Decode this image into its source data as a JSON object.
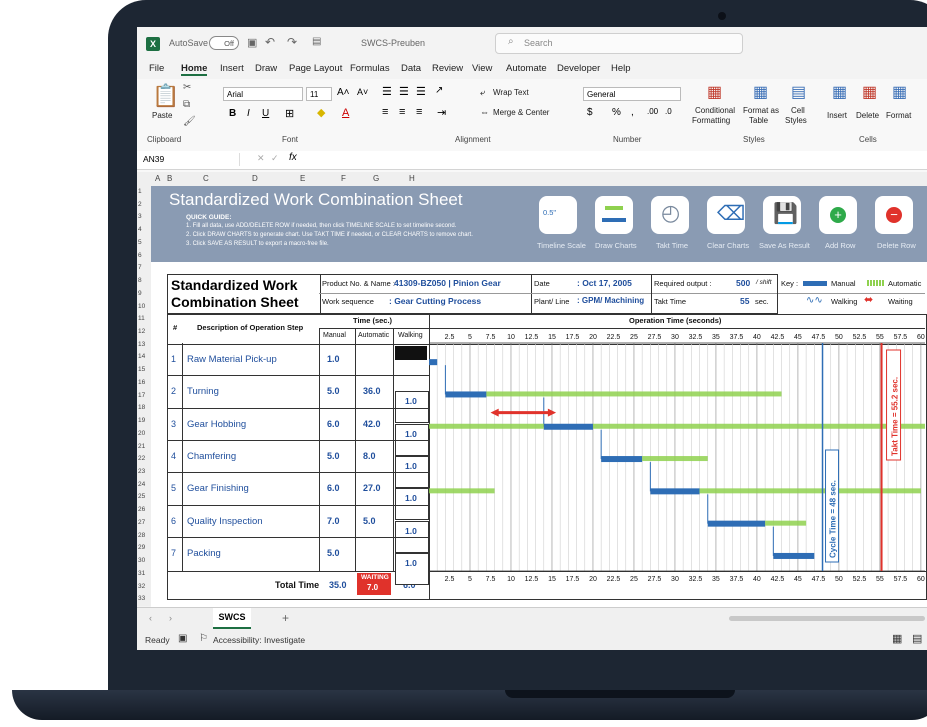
{
  "titlebar": {
    "autosave_label": "AutoSave",
    "autosave_state": "Off",
    "filename": "SWCS-Preuben",
    "search_placeholder": "Search"
  },
  "menu": [
    "File",
    "Home",
    "Insert",
    "Draw",
    "Page Layout",
    "Formulas",
    "Data",
    "Review",
    "View",
    "Automate",
    "Developer",
    "Help"
  ],
  "ribbon": {
    "paste": "Paste",
    "font_name": "Arial",
    "font_size": "11",
    "wrap_text": "Wrap Text",
    "merge_center": "Merge & Center",
    "number_format": "General",
    "conditional": "Conditional",
    "formatting": "Formatting",
    "format_as": "Format as",
    "table": "Table",
    "cell": "Cell",
    "styles": "Styles",
    "insert": "Insert",
    "delete": "Delete",
    "format": "Format",
    "groups": {
      "clipboard": "Clipboard",
      "font": "Font",
      "alignment": "Alignment",
      "number": "Number",
      "styles": "Styles",
      "cells": "Cells"
    }
  },
  "formula_bar": {
    "name_box": "AN39",
    "fx": "fx"
  },
  "columns": [
    "A",
    "B",
    "C",
    "D",
    "E",
    "F",
    "G",
    "H"
  ],
  "rows": [
    "1",
    "2",
    "3",
    "4",
    "5",
    "6",
    "7",
    "8",
    "9",
    "10",
    "11",
    "12",
    "13",
    "14",
    "15",
    "16",
    "17",
    "18",
    "19",
    "20",
    "21",
    "22",
    "23",
    "24",
    "25",
    "26",
    "27",
    "28",
    "29",
    "30",
    "31",
    "32",
    "33"
  ],
  "banner": {
    "title": "Standardized Work Combination Sheet",
    "guide_title": "QUICK GUIDE:",
    "guide_lines": [
      "1. Fill all data, use ADD/DELETE ROW if needed, then click TIMELINE SCALE to set timeline second.",
      "2. Click DRAW CHARTS to generate chart. Use TAKT TIME if needed, or CLEAR CHARTS to remove chart.",
      "3. Click SAVE AS RESULT to export a macro-free file."
    ],
    "scale_value": "0.5\"",
    "buttons": [
      "Timeline Scale",
      "Draw Charts",
      "Takt Time",
      "Clear Charts",
      "Save As Result",
      "Add Row",
      "Delete Row"
    ]
  },
  "sheet": {
    "title_line1": "Standardized Work",
    "title_line2": "Combination Sheet",
    "product_label": "Product No. & Name :",
    "product_value": "41309-BZ050 | Pinion Gear",
    "sequence_label": "Work sequence",
    "sequence_value": ": Gear Cutting Process",
    "date_label": "Date",
    "date_value": ": Oct 17, 2005",
    "plant_label": "Plant/ Line",
    "plant_value": ": GPM/ Machining",
    "required_label": "Required output :",
    "required_value": "500",
    "required_unit": "/ shift",
    "takt_label": "Takt Time",
    "takt_value": "55",
    "takt_unit": "sec.",
    "key_label": "Key :",
    "key_manual": "Manual",
    "key_automatic": "Automatic",
    "key_walking": "Walking",
    "key_waiting": "Waiting",
    "hdr_no": "#",
    "hdr_desc": "Description of Operation Step",
    "hdr_time": "Time (sec.)",
    "hdr_manual": "Manual",
    "hdr_auto": "Automatic",
    "hdr_walk": "Walking",
    "hdr_optime": "Operation Time (seconds)",
    "total_label": "Total Time",
    "total_manual": "35.0",
    "waiting_label": "WAITING",
    "waiting_value": "7.0",
    "total_walk": "6.0",
    "cycle_label": "Cycle Time = 48 sec.",
    "takt_line_label": "Takt Time = 55.2 sec."
  },
  "steps": [
    {
      "no": "1",
      "desc": "Raw Material Pick-up",
      "manual": "1.0",
      "auto": "",
      "walk": "",
      "start": 0,
      "m": 1.0,
      "a": 0
    },
    {
      "no": "2",
      "desc": "Turning",
      "manual": "5.0",
      "auto": "36.0",
      "walk": "1.0",
      "start": 2,
      "m": 5.0,
      "a": 36
    },
    {
      "no": "3",
      "desc": "Gear Hobbing",
      "manual": "6.0",
      "auto": "42.0",
      "walk": "1.0",
      "start": 14,
      "m": 6.0,
      "a": 42
    },
    {
      "no": "4",
      "desc": "Chamfering",
      "manual": "5.0",
      "auto": "8.0",
      "walk": "1.0",
      "start": 21,
      "m": 5.0,
      "a": 8
    },
    {
      "no": "5",
      "desc": "Gear Finishing",
      "manual": "6.0",
      "auto": "27.0",
      "walk": "1.0",
      "start": 27,
      "m": 6.0,
      "a": 27
    },
    {
      "no": "6",
      "desc": "Quality Inspection",
      "manual": "7.0",
      "auto": "5.0",
      "walk": "1.0",
      "start": 34,
      "m": 7.0,
      "a": 5
    },
    {
      "no": "7",
      "desc": "Packing",
      "manual": "5.0",
      "auto": "",
      "walk": "1.0",
      "start": 42,
      "m": 5.0,
      "a": 0
    }
  ],
  "axis_ticks": [
    "2.5",
    "5",
    "7.5",
    "10",
    "12.5",
    "15",
    "17.5",
    "20",
    "22.5",
    "25",
    "27.5",
    "30",
    "32.5",
    "35",
    "37.5",
    "40",
    "42.5",
    "45",
    "47.5",
    "50",
    "52.5",
    "55",
    "57.5",
    "60"
  ],
  "tabs": {
    "sheet": "SWCS"
  },
  "status": {
    "ready": "Ready",
    "accessibility": "Accessibility: Investigate"
  },
  "colors": {
    "manual": "#2e6db5",
    "automatic": "#8fd14f",
    "waiting": "#e0322b",
    "banner": "#8a9bb3"
  }
}
